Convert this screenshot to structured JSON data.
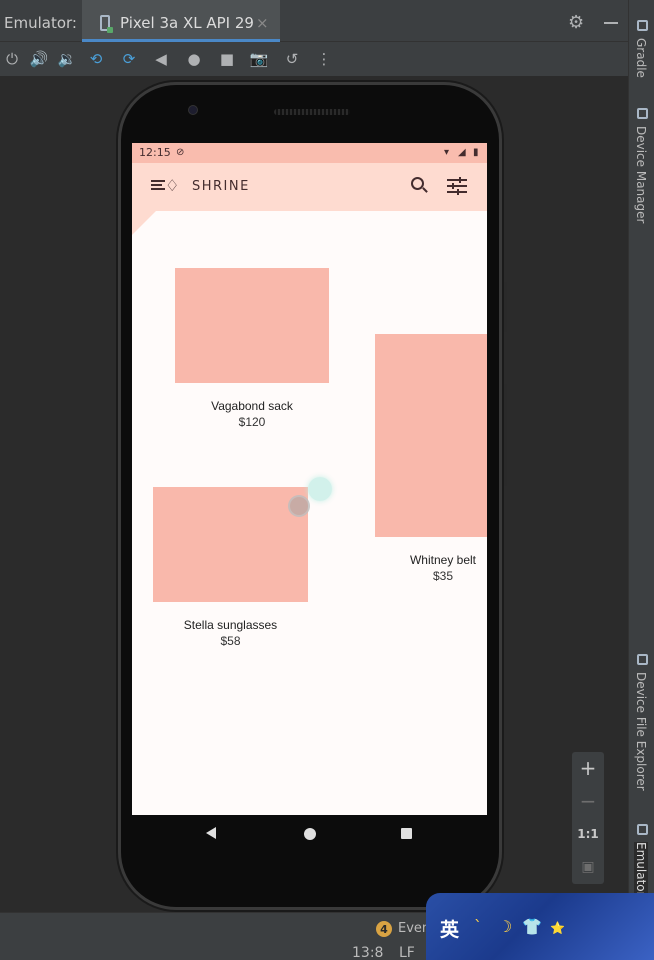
{
  "ide": {
    "panel_label": "Emulator:",
    "tab_title": "Pixel 3a XL API 29",
    "tab_close": "×",
    "toolbar_icons": [
      "power-icon",
      "volume-up-icon",
      "volume-down-icon",
      "rotate-left-icon",
      "rotate-right-icon",
      "back-icon",
      "home-icon",
      "overview-icon",
      "screenshot-icon",
      "snapshot-icon",
      "more-icon"
    ],
    "side_tools": [
      "Gradle",
      "Device Manager",
      "Device File Explorer",
      "Emulator"
    ],
    "zoom": {
      "zoom_in": "+",
      "zoom_out": "−",
      "actual_size": "1:1"
    },
    "events": {
      "count": "4",
      "label": "Even"
    },
    "status": {
      "position": "13:8",
      "line_ending": "LF"
    },
    "ime": {
      "char": "英",
      "symbols": [
        "ˋ",
        "☽",
        "👕",
        "⭐"
      ]
    }
  },
  "device": {
    "status_bar": {
      "time": "12:15"
    },
    "app_bar": {
      "brand": "SHRINE"
    },
    "products": [
      {
        "name": "Vagabond sack",
        "price": "$120"
      },
      {
        "name": "Whitney belt",
        "price": "$35"
      },
      {
        "name": "Stella sunglasses",
        "price": "$58"
      }
    ]
  },
  "colors": {
    "ide_bg": "#2b2b2b",
    "ide_panel": "#3c3f41",
    "accent": "#4a88c7",
    "shrine_pink": "#fedbd0",
    "shrine_pink_dark": "#f9bcae",
    "product_placeholder": "#f9b8ab",
    "shrine_brown": "#442c2e"
  }
}
